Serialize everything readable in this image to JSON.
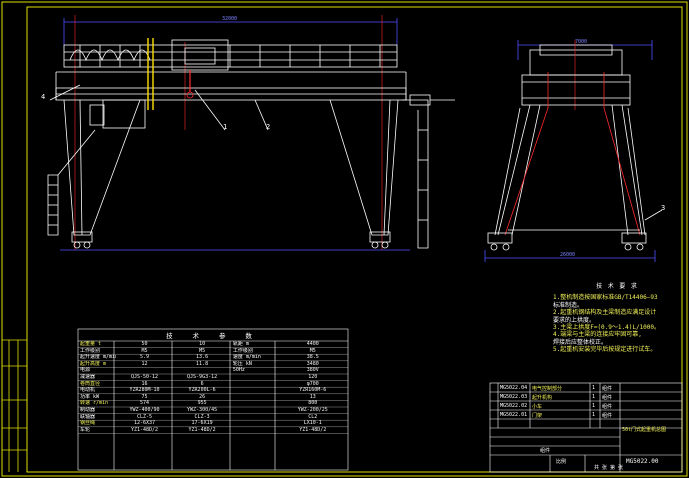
{
  "drawing": {
    "callouts": {
      "c1": "1",
      "c2": "2",
      "c3": "3",
      "c4": "4"
    },
    "dimension_labels": {
      "span_top": "32000",
      "bottom_span": "26000",
      "side_width": "7000"
    },
    "colors": {
      "background": "#000000",
      "frame": "#e0e000",
      "structure": "#ffffff",
      "dimension": "#4f4fff",
      "centerline": "#ff2b2b",
      "accent": "#ffe000"
    }
  },
  "technical_notes": {
    "title": "技 术 要 求",
    "lines": [
      "1.整机制造按国家标准GB/T14406—93",
      "  标准制造。",
      "2.起重机钢结构及主梁制造应满足设计",
      "  要求的上拱度。",
      "3.主梁上拱度F=(0.9～1.4)L/1000。",
      "4.端梁与主梁的连接应牢固可靠,",
      "  焊接后应整体校正。",
      "5.起重机安装完毕后按规定进行试车。"
    ]
  },
  "param_table": {
    "title": "技 术 参 数",
    "rows": [
      [
        "起重量 t",
        "50",
        "10",
        "轨距 m",
        "4400"
      ],
      [
        "工作级别",
        "M5",
        "M5",
        "工作级别",
        "M5"
      ],
      [
        "起升速度 m/min",
        "5.9",
        "13.6",
        "速度 m/min",
        "38.5"
      ],
      [
        "起升高度 m",
        "12",
        "11.8",
        "轮压 kN",
        "3480"
      ],
      [
        "电源",
        "",
        "",
        "50Hz",
        "380V"
      ],
      [
        "减速器",
        "QJS-50-12",
        "QJS-9G3-12",
        "",
        "120"
      ],
      [
        "卷筒直径",
        "16",
        "6",
        "",
        "φ700"
      ],
      [
        "电动机",
        "YZR280M-10",
        "YZR200L-6",
        "",
        "YZR160M-6"
      ],
      [
        "功率 kW",
        "75",
        "26",
        "",
        "13"
      ],
      [
        "转速 r/min",
        "574",
        "955",
        "",
        "800"
      ],
      [
        "制动器",
        "YWZ-400/90",
        "YWZ-300/45",
        "",
        "YWZ-200/25"
      ],
      [
        "联轴器",
        "CLZ-5",
        "CLZ-3",
        "",
        "CL2"
      ],
      [
        "钢丝绳",
        "12-6X37",
        "17-6X19",
        "",
        "LX10-1"
      ],
      [
        "车轮",
        "YZ1-48D/2",
        "YZ1-48D/2",
        "",
        "YZ1-48D/2"
      ]
    ]
  },
  "title_block": {
    "title": "50t门式起重机总图",
    "drawing_no": "MG5022.00",
    "material": "组件",
    "scale": "比例",
    "sheet": "共 张 第 张",
    "rows": [
      [
        "MG5022.04",
        "电气控制部分",
        "1",
        "组件"
      ],
      [
        "MG5022.03",
        "起升机构",
        "1",
        "组件"
      ],
      [
        "MG5022.02",
        "小车",
        "1",
        "组件"
      ],
      [
        "MG5022.01",
        "门架",
        "1",
        "组件"
      ]
    ]
  }
}
